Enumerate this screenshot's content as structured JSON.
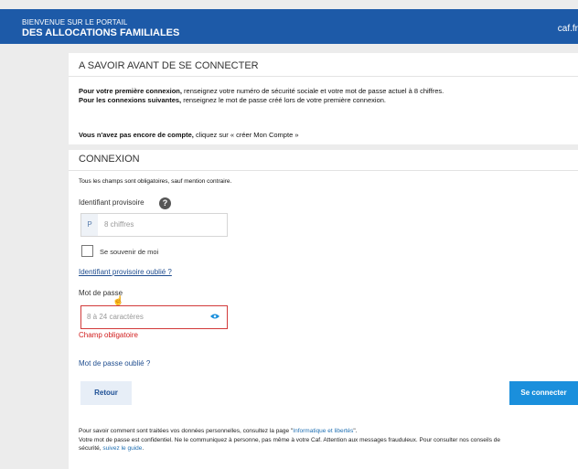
{
  "header": {
    "welcome": "BIENVENUE SUR LE PORTAIL",
    "title": "DES ALLOCATIONS FAMILIALES",
    "brand": "caf.fr"
  },
  "info": {
    "title": "A SAVOIR AVANT DE SE CONNECTER",
    "first_bold": "Pour votre première connexion,",
    "first_rest": " renseignez votre numéro de sécurité sociale et votre mot de passe actuel à 8 chiffres.",
    "next_bold": "Pour les connexions suivantes,",
    "next_rest": " renseignez le mot de passe créé lors de votre première connexion.",
    "no_account_bold": "Vous n'avez pas encore de compte,",
    "no_account_rest": " cliquez sur « créer Mon Compte »"
  },
  "login": {
    "title": "CONNEXION",
    "mandatory_note": "Tous les champs sont obligatoires, sauf mention contraire.",
    "id_label": "Identifiant provisoire",
    "help_symbol": "?",
    "id_prefix": "P",
    "id_placeholder": "8 chiffres",
    "remember_label": "Se souvenir de moi",
    "forgot_id": "Identifiant provisoire oublié ?",
    "pwd_label": "Mot de passe",
    "pwd_placeholder": "8 à 24 caractères",
    "error": "Champ obligatoire",
    "forgot_pwd": "Mot de passe oublié ?",
    "back": "Retour",
    "submit": "Se connecter"
  },
  "footer": {
    "line1_pre": "Pour savoir comment sont traitées vos données personnelles, consultez la page \"",
    "line1_link": "Informatique et libertés",
    "line1_post": "\".",
    "line2": "Votre mot de passe est confidentiel. Ne le communiquez à personne, pas même à votre Caf. Attention aux messages frauduleux. Pour consulter nos conseils de",
    "line3_pre": "sécurité, ",
    "line3_link": "suivez le guide",
    "line3_post": "."
  },
  "colors": {
    "header_bg": "#1d5aa8",
    "primary_button": "#1a8fdc",
    "error": "#d11d1d"
  },
  "icons": {
    "help": "help-question-icon",
    "eye": "eye-icon",
    "cursor": "hand-cursor-icon"
  }
}
